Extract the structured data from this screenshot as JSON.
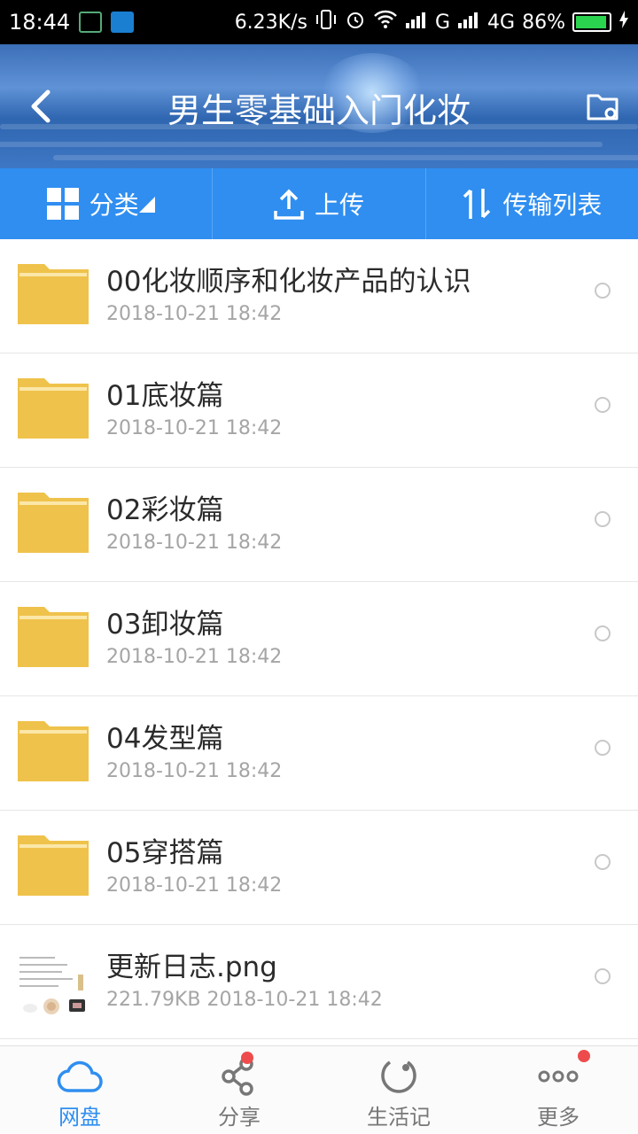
{
  "status_bar": {
    "time": "18:44",
    "speed": "6.23K/s",
    "net1": "G",
    "net2": "4G",
    "battery": "86%"
  },
  "header": {
    "title": "男生零基础入门化妆"
  },
  "toolbar": {
    "category": "分类",
    "upload": "上传",
    "transfer": "传输列表"
  },
  "files": [
    {
      "name": "00化妆顺序和化妆产品的认识",
      "meta": "2018-10-21  18:42",
      "type": "folder"
    },
    {
      "name": "01底妆篇",
      "meta": "2018-10-21  18:42",
      "type": "folder"
    },
    {
      "name": "02彩妆篇",
      "meta": "2018-10-21  18:42",
      "type": "folder"
    },
    {
      "name": "03卸妆篇",
      "meta": "2018-10-21  18:42",
      "type": "folder"
    },
    {
      "name": "04发型篇",
      "meta": "2018-10-21  18:42",
      "type": "folder"
    },
    {
      "name": "05穿搭篇",
      "meta": "2018-10-21  18:42",
      "type": "folder"
    },
    {
      "name": "更新日志.png",
      "meta": "221.79KB   2018-10-21  18:42",
      "type": "image"
    }
  ],
  "bottom_nav": [
    {
      "label": "网盘",
      "active": true
    },
    {
      "label": "分享",
      "badge": true
    },
    {
      "label": "生活记"
    },
    {
      "label": "更多",
      "badge": true
    }
  ],
  "colors": {
    "accent": "#2f8ef0",
    "folder": "#efc24b",
    "badge": "#ee4c4c"
  }
}
